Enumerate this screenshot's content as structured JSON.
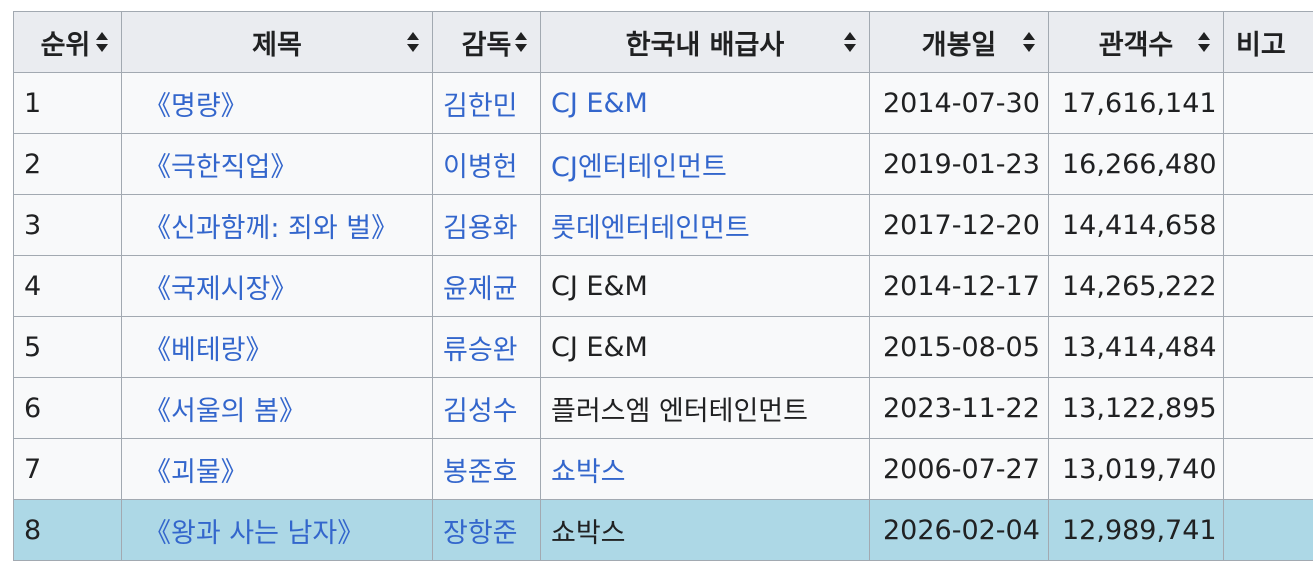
{
  "table": {
    "headers": [
      {
        "label": "순위",
        "sortable": true
      },
      {
        "label": "제목",
        "sortable": true
      },
      {
        "label": "감독",
        "sortable": true
      },
      {
        "label": "한국내 배급사",
        "sortable": true
      },
      {
        "label": "개봉일",
        "sortable": true
      },
      {
        "label": "관객수",
        "sortable": true
      },
      {
        "label": "비고",
        "sortable": false
      }
    ],
    "rows": [
      {
        "rank": "1",
        "title": "《명량》",
        "director": "김한민",
        "distributor": "CJ E&M",
        "distributor_linked": true,
        "release": "2014-07-30",
        "audience": "17,616,141",
        "note": ""
      },
      {
        "rank": "2",
        "title": "《극한직업》",
        "director": "이병헌",
        "distributor": "CJ엔터테인먼트",
        "distributor_linked": true,
        "release": "2019-01-23",
        "audience": "16,266,480",
        "note": ""
      },
      {
        "rank": "3",
        "title": "《신과함께: 죄와 벌》",
        "director": "김용화",
        "distributor": "롯데엔터테인먼트",
        "distributor_linked": true,
        "release": "2017-12-20",
        "audience": "14,414,658",
        "note": ""
      },
      {
        "rank": "4",
        "title": "《국제시장》",
        "director": "윤제균",
        "distributor": "CJ E&M",
        "distributor_linked": false,
        "release": "2014-12-17",
        "audience": "14,265,222",
        "note": ""
      },
      {
        "rank": "5",
        "title": "《베테랑》",
        "director": "류승완",
        "distributor": "CJ E&M",
        "distributor_linked": false,
        "release": "2015-08-05",
        "audience": "13,414,484",
        "note": ""
      },
      {
        "rank": "6",
        "title": "《서울의 봄》",
        "director": "김성수",
        "distributor": "플러스엠 엔터테인먼트",
        "distributor_linked": false,
        "release": "2023-11-22",
        "audience": "13,122,895",
        "note": ""
      },
      {
        "rank": "7",
        "title": "《괴물》",
        "director": "봉준호",
        "distributor": "쇼박스",
        "distributor_linked": true,
        "release": "2006-07-27",
        "audience": "13,019,740",
        "note": ""
      },
      {
        "rank": "8",
        "title": "《왕과 사는 남자》",
        "director": "장항준",
        "distributor": "쇼박스",
        "distributor_linked": false,
        "release": "2026-02-04",
        "audience": "12,989,741",
        "note": "",
        "highlighted": true
      }
    ]
  },
  "colors": {
    "link": "#3366cc",
    "header_bg": "#eaecf0",
    "cell_bg": "#f8f9fa",
    "highlight_bg": "#add8e6",
    "border": "#a2a9b1",
    "text": "#202122"
  }
}
